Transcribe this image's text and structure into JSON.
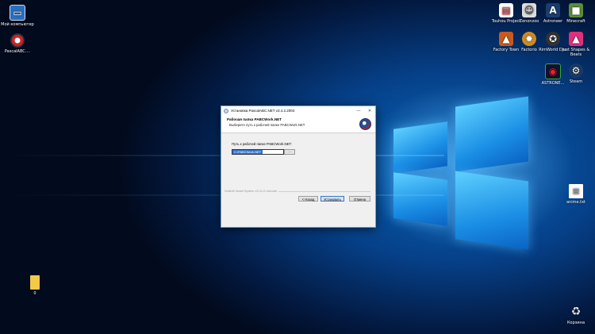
{
  "desktop": {
    "icons_left": [
      {
        "label": "Мой компьютер",
        "icon": "computer-icon"
      },
      {
        "label": "PascalABC....",
        "icon": "pascal-icon"
      }
    ],
    "icons_right": [
      {
        "label": "Touhou Project",
        "icon": "file-icon"
      },
      {
        "label": "Zenonzoo",
        "icon": "game-icon"
      },
      {
        "label": "Astroneer",
        "icon": "astroneer-icon"
      },
      {
        "label": "Minecraft",
        "icon": "minecraft-icon"
      },
      {
        "label": "Factory Town",
        "icon": "factory-town-icon"
      },
      {
        "label": "Factorio",
        "icon": "factorio-icon"
      },
      {
        "label": "RimWorld Dev",
        "icon": "rimworld-icon"
      },
      {
        "label": "Just Shapes & Beats",
        "icon": "jsab-icon"
      },
      {
        "label": "ASTRONE...",
        "icon": "astroneer-icon"
      },
      {
        "label": "Steam",
        "icon": "steam-icon"
      },
      {
        "label": "anime.txt",
        "icon": "text-file-icon"
      },
      {
        "label": "Корзина",
        "icon": "recycle-bin-icon"
      }
    ],
    "folder": {
      "label": "0",
      "icon": "folder-icon"
    }
  },
  "dialog": {
    "title": "Установка PascalABC.NET v3.4.2.2004",
    "minimize": "—",
    "close": "✕",
    "header_title": "Рабочая папка PABCWork.NET",
    "header_subtitle": "Выберите путь к рабочей папке PABCWork.NET",
    "path_label": "Путь к рабочей папке PABCWork.NET:",
    "path_value": "C:\\PABCWork.NET",
    "browse_label": "...",
    "footer_text": "Nullsoft Install System v3.04-2-Unicode",
    "back_label": "< Назад",
    "install_label": "Установить",
    "cancel_label": "Отмена"
  },
  "colors": {
    "accent": "#3075d6",
    "wallpaper": "#06418a"
  }
}
